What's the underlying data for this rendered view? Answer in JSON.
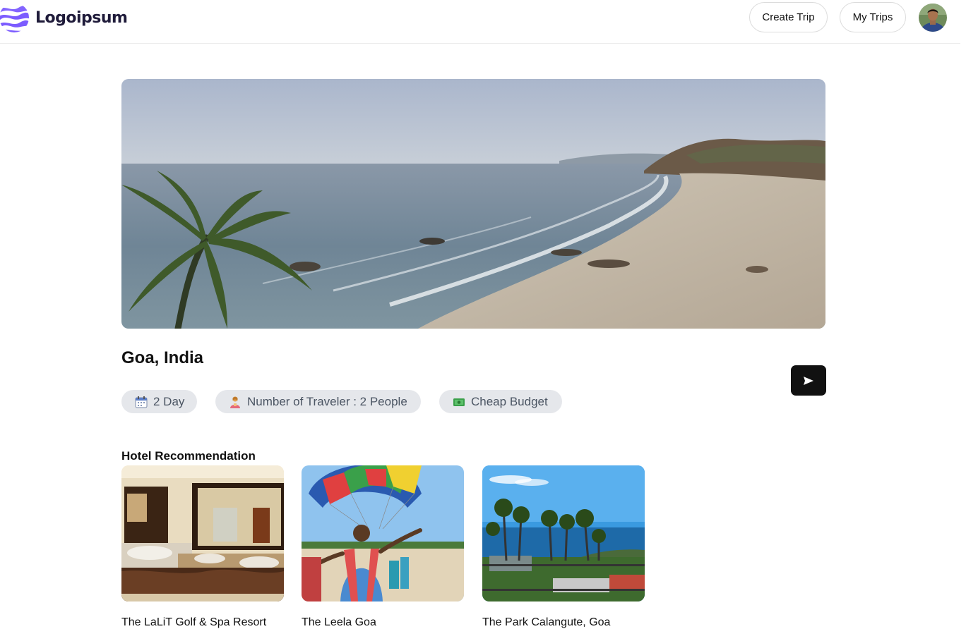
{
  "header": {
    "logo_text": "Logoipsum",
    "create_trip_label": "Create Trip",
    "my_trips_label": "My Trips"
  },
  "trip": {
    "destination": "Goa, India",
    "chips": {
      "days": "2 Day",
      "travelers": "Number of Traveler : 2 People",
      "budget": "Cheap Budget"
    }
  },
  "hotels": {
    "section_title": "Hotel Recommendation",
    "items": [
      {
        "name": "The LaLiT Golf & Spa Resort"
      },
      {
        "name": "The Leela Goa"
      },
      {
        "name": "The Park Calangute, Goa"
      }
    ]
  },
  "colors": {
    "brand_purple": "#7c5cff",
    "chip_bg": "#e5e7eb",
    "share_button_bg": "#111111"
  },
  "icons": [
    "logo-wave-icon",
    "calendar-icon",
    "traveler-icon",
    "money-icon",
    "send-icon"
  ]
}
